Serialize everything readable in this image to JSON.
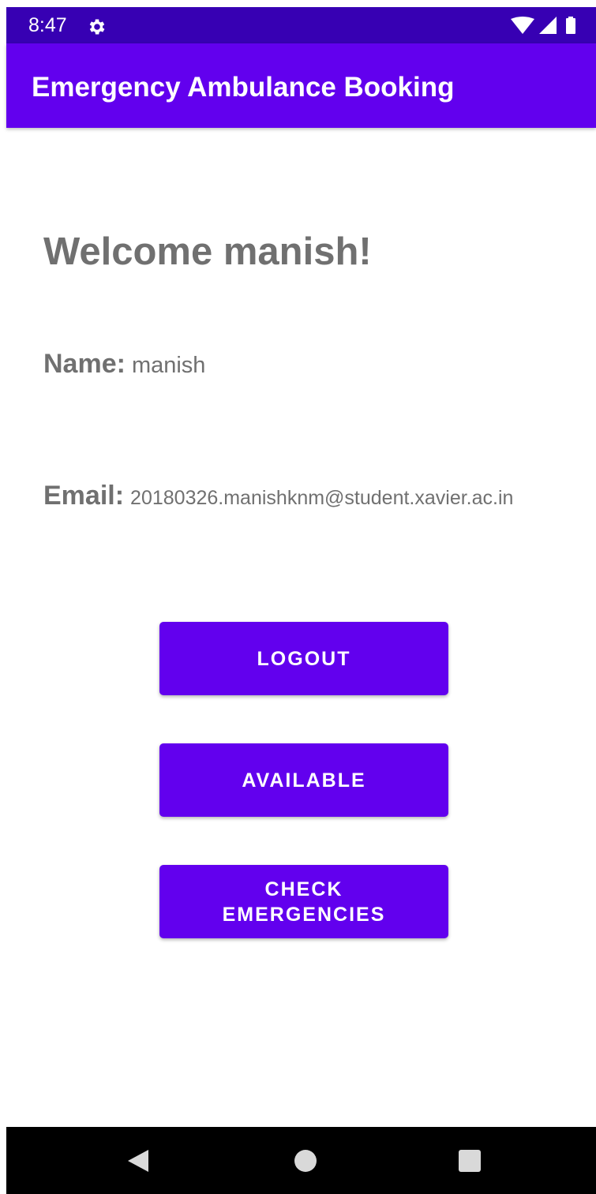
{
  "status_bar": {
    "time": "8:47",
    "icons": [
      "gear-icon",
      "wifi-icon",
      "signal-icon",
      "battery-icon"
    ]
  },
  "app_bar": {
    "title": "Emergency Ambulance Booking"
  },
  "main": {
    "welcome": "Welcome manish!",
    "name_label": "Name:",
    "name_value": "manish",
    "email_label": "Email:",
    "email_value": "20180326.manishknm@student.xavier.ac.in"
  },
  "buttons": {
    "logout": "LOGOUT",
    "available": "AVAILABLE",
    "check_emergencies": "CHECK EMERGENCIES"
  },
  "nav_bar": {
    "icons": [
      "back-icon",
      "home-icon",
      "recents-icon"
    ]
  },
  "colors": {
    "status_bar": "#3700b3",
    "primary": "#6200ee",
    "text_gray": "#707070"
  }
}
